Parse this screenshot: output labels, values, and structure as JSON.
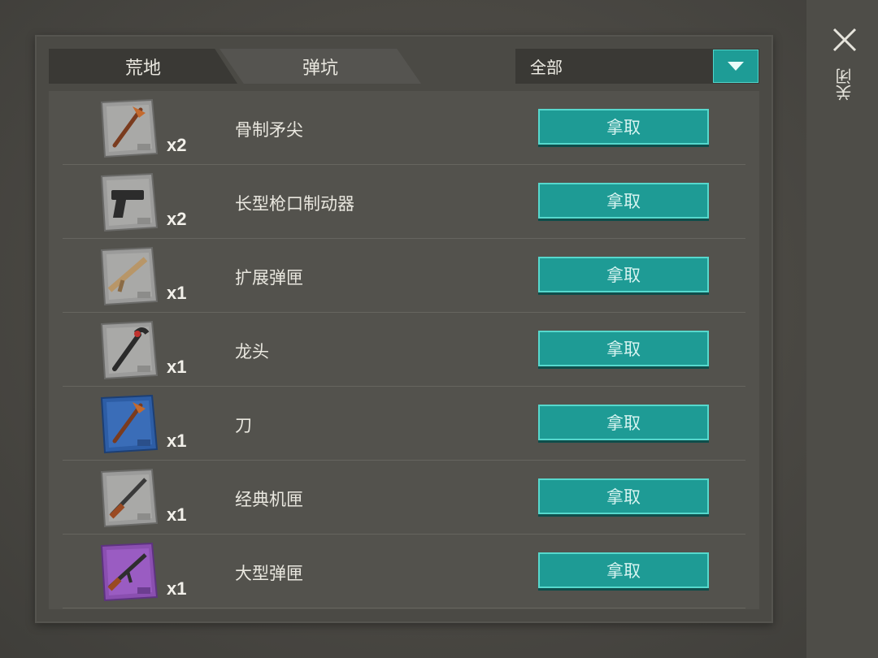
{
  "tabs": [
    {
      "label": "荒地"
    },
    {
      "label": "弹坑"
    }
  ],
  "filter": {
    "selected": "全部",
    "icon": "chevron-down-icon"
  },
  "close": {
    "label": "关闭",
    "icon": "close-icon"
  },
  "items": [
    {
      "name": "骨制矛尖",
      "qty": "x2",
      "icon": "pickaxe-icon",
      "card_color": "#9a9a9a",
      "take_label": "拿取"
    },
    {
      "name": "长型枪口制动器",
      "qty": "x2",
      "icon": "pistol-icon",
      "card_color": "#9a9a9a",
      "take_label": "拿取"
    },
    {
      "name": "扩展弹匣",
      "qty": "x1",
      "icon": "rifle-icon",
      "card_color": "#9a9a9a",
      "take_label": "拿取"
    },
    {
      "name": "龙头",
      "qty": "x1",
      "icon": "crowbar-icon",
      "card_color": "#9a9a9a",
      "take_label": "拿取"
    },
    {
      "name": "刀",
      "qty": "x1",
      "icon": "pickaxe-icon",
      "card_color": "#2e5fa8",
      "take_label": "拿取"
    },
    {
      "name": "经典机匣",
      "qty": "x1",
      "icon": "shotgun-icon",
      "card_color": "#9a9a9a",
      "take_label": "拿取"
    },
    {
      "name": "大型弹匣",
      "qty": "x1",
      "icon": "assault-rifle-icon",
      "card_color": "#8a4fb0",
      "take_label": "拿取"
    }
  ],
  "colors": {
    "accent": "#1e9b95",
    "accent_border": "#56d8cd"
  }
}
